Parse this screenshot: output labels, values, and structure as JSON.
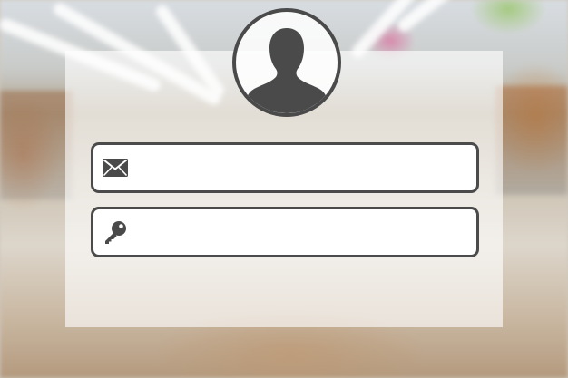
{
  "login_form": {
    "avatar_icon": "user-silhouette-icon",
    "email": {
      "icon": "envelope-icon",
      "value": "",
      "placeholder": ""
    },
    "password": {
      "icon": "key-icon",
      "value": "",
      "placeholder": ""
    }
  },
  "colors": {
    "icon_gray": "#4a4a4a",
    "field_border": "#4b4b4b",
    "field_background": "#ffffff",
    "panel_overlay": "rgba(255,255,255,0.62)"
  }
}
